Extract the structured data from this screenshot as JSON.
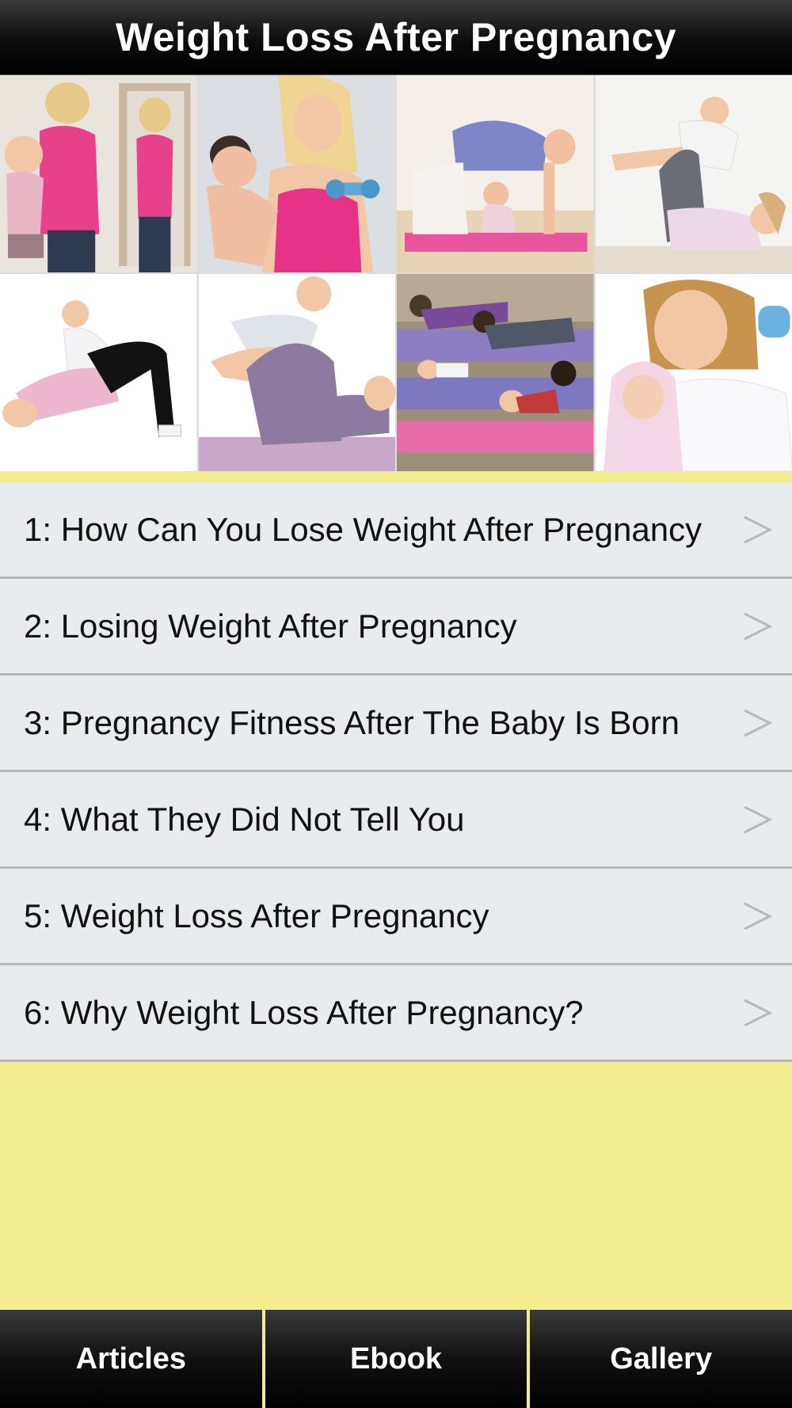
{
  "header": {
    "title": "Weight Loss After Pregnancy"
  },
  "hero": {
    "photos": [
      {
        "name": "photo-mom-baby-mirror"
      },
      {
        "name": "photo-mom-baby-dumbbell"
      },
      {
        "name": "photo-cat-pose-baby"
      },
      {
        "name": "photo-leg-lift-baby"
      },
      {
        "name": "photo-bridge-pose-baby"
      },
      {
        "name": "photo-airplane-baby"
      },
      {
        "name": "photo-class-pushups"
      },
      {
        "name": "photo-mom-baby-smile"
      }
    ]
  },
  "articles": [
    {
      "label": "1: How Can You Lose Weight After Pregnancy"
    },
    {
      "label": "2: Losing Weight After Pregnancy"
    },
    {
      "label": "3: Pregnancy Fitness After The Baby Is Born"
    },
    {
      "label": "4: What They Did Not Tell You"
    },
    {
      "label": "5: Weight Loss After Pregnancy"
    },
    {
      "label": "6: Why Weight Loss After Pregnancy?"
    }
  ],
  "tabs": [
    {
      "label": "Articles"
    },
    {
      "label": "Ebook"
    },
    {
      "label": "Gallery"
    }
  ],
  "colors": {
    "background": "#f2ee90",
    "row": "#e8ecee",
    "chevron": "#b8b8b8"
  }
}
